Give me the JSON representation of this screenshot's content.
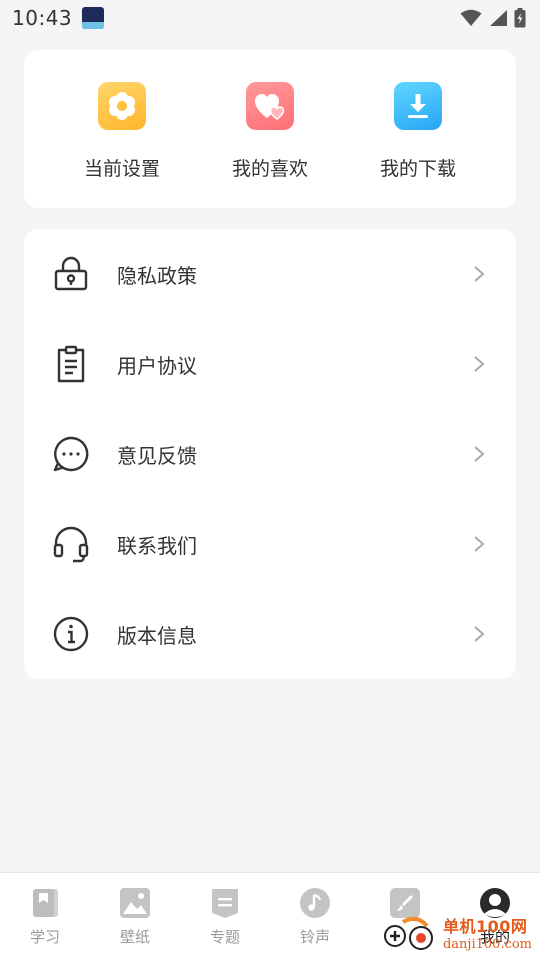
{
  "status_bar": {
    "time": "10:43",
    "icons": [
      "app-notification-icon",
      "wifi-icon",
      "signal-icon",
      "battery-charging-icon"
    ]
  },
  "quick_actions": [
    {
      "label": "当前设置",
      "icon": "settings-flower-icon",
      "color": "#ffc23a"
    },
    {
      "label": "我的喜欢",
      "icon": "hearts-icon",
      "color": "#ff7f86"
    },
    {
      "label": "我的下载",
      "icon": "download-icon",
      "color": "#35b4f8"
    }
  ],
  "menu": [
    {
      "label": "隐私政策",
      "icon": "lock-icon"
    },
    {
      "label": "用户协议",
      "icon": "clipboard-icon"
    },
    {
      "label": "意见反馈",
      "icon": "chat-bubble-icon"
    },
    {
      "label": "联系我们",
      "icon": "headset-icon"
    },
    {
      "label": "版本信息",
      "icon": "info-icon"
    }
  ],
  "tabs": [
    {
      "label": "学习",
      "icon": "book-icon",
      "active": false
    },
    {
      "label": "壁纸",
      "icon": "image-icon",
      "active": false
    },
    {
      "label": "专题",
      "icon": "topic-icon",
      "active": false
    },
    {
      "label": "铃声",
      "icon": "music-note-icon",
      "active": false
    },
    {
      "label": "",
      "icon": "brush-icon",
      "active": false
    },
    {
      "label": "我的",
      "icon": "profile-icon",
      "active": true
    }
  ],
  "watermark": {
    "cn": "单机100网",
    "en": "danji100.com"
  },
  "colors": {
    "page_background": "#f5f5f7",
    "card_background": "#ffffff",
    "tab_inactive": "#9a9a9a",
    "tab_active": "#222222",
    "watermark": "#e35b1b"
  }
}
